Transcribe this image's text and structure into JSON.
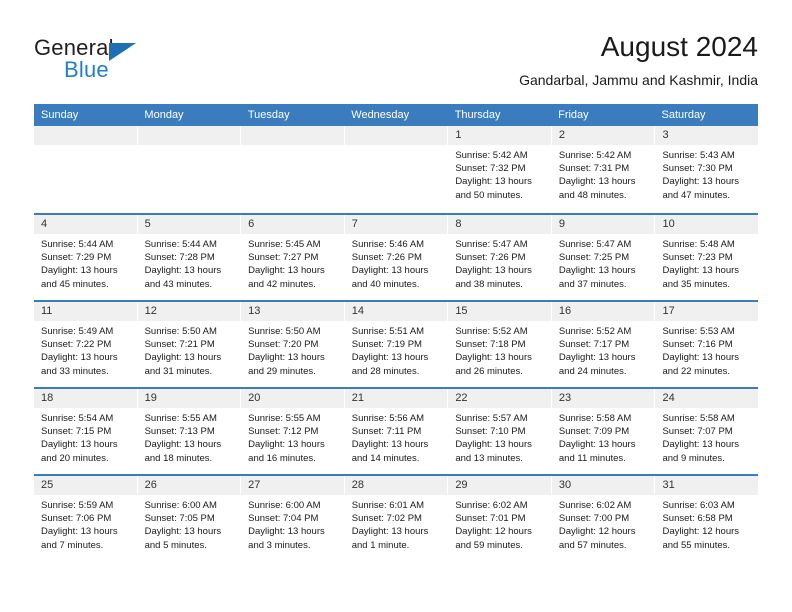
{
  "brand": {
    "name_part1": "General",
    "name_part2": "Blue",
    "accent_color": "#1f7fd0",
    "header_color": "#3a7cbe"
  },
  "header": {
    "title": "August 2024",
    "subtitle": "Gandarbal, Jammu and Kashmir, India"
  },
  "weekday_headers": [
    "Sunday",
    "Monday",
    "Tuesday",
    "Wednesday",
    "Thursday",
    "Friday",
    "Saturday"
  ],
  "weeks": [
    [
      {
        "day": "",
        "lines": [
          "",
          "",
          "",
          ""
        ]
      },
      {
        "day": "",
        "lines": [
          "",
          "",
          "",
          ""
        ]
      },
      {
        "day": "",
        "lines": [
          "",
          "",
          "",
          ""
        ]
      },
      {
        "day": "",
        "lines": [
          "",
          "",
          "",
          ""
        ]
      },
      {
        "day": "1",
        "lines": [
          "Sunrise: 5:42 AM",
          "Sunset: 7:32 PM",
          "Daylight: 13 hours",
          "and 50 minutes."
        ]
      },
      {
        "day": "2",
        "lines": [
          "Sunrise: 5:42 AM",
          "Sunset: 7:31 PM",
          "Daylight: 13 hours",
          "and 48 minutes."
        ]
      },
      {
        "day": "3",
        "lines": [
          "Sunrise: 5:43 AM",
          "Sunset: 7:30 PM",
          "Daylight: 13 hours",
          "and 47 minutes."
        ]
      }
    ],
    [
      {
        "day": "4",
        "lines": [
          "Sunrise: 5:44 AM",
          "Sunset: 7:29 PM",
          "Daylight: 13 hours",
          "and 45 minutes."
        ]
      },
      {
        "day": "5",
        "lines": [
          "Sunrise: 5:44 AM",
          "Sunset: 7:28 PM",
          "Daylight: 13 hours",
          "and 43 minutes."
        ]
      },
      {
        "day": "6",
        "lines": [
          "Sunrise: 5:45 AM",
          "Sunset: 7:27 PM",
          "Daylight: 13 hours",
          "and 42 minutes."
        ]
      },
      {
        "day": "7",
        "lines": [
          "Sunrise: 5:46 AM",
          "Sunset: 7:26 PM",
          "Daylight: 13 hours",
          "and 40 minutes."
        ]
      },
      {
        "day": "8",
        "lines": [
          "Sunrise: 5:47 AM",
          "Sunset: 7:26 PM",
          "Daylight: 13 hours",
          "and 38 minutes."
        ]
      },
      {
        "day": "9",
        "lines": [
          "Sunrise: 5:47 AM",
          "Sunset: 7:25 PM",
          "Daylight: 13 hours",
          "and 37 minutes."
        ]
      },
      {
        "day": "10",
        "lines": [
          "Sunrise: 5:48 AM",
          "Sunset: 7:23 PM",
          "Daylight: 13 hours",
          "and 35 minutes."
        ]
      }
    ],
    [
      {
        "day": "11",
        "lines": [
          "Sunrise: 5:49 AM",
          "Sunset: 7:22 PM",
          "Daylight: 13 hours",
          "and 33 minutes."
        ]
      },
      {
        "day": "12",
        "lines": [
          "Sunrise: 5:50 AM",
          "Sunset: 7:21 PM",
          "Daylight: 13 hours",
          "and 31 minutes."
        ]
      },
      {
        "day": "13",
        "lines": [
          "Sunrise: 5:50 AM",
          "Sunset: 7:20 PM",
          "Daylight: 13 hours",
          "and 29 minutes."
        ]
      },
      {
        "day": "14",
        "lines": [
          "Sunrise: 5:51 AM",
          "Sunset: 7:19 PM",
          "Daylight: 13 hours",
          "and 28 minutes."
        ]
      },
      {
        "day": "15",
        "lines": [
          "Sunrise: 5:52 AM",
          "Sunset: 7:18 PM",
          "Daylight: 13 hours",
          "and 26 minutes."
        ]
      },
      {
        "day": "16",
        "lines": [
          "Sunrise: 5:52 AM",
          "Sunset: 7:17 PM",
          "Daylight: 13 hours",
          "and 24 minutes."
        ]
      },
      {
        "day": "17",
        "lines": [
          "Sunrise: 5:53 AM",
          "Sunset: 7:16 PM",
          "Daylight: 13 hours",
          "and 22 minutes."
        ]
      }
    ],
    [
      {
        "day": "18",
        "lines": [
          "Sunrise: 5:54 AM",
          "Sunset: 7:15 PM",
          "Daylight: 13 hours",
          "and 20 minutes."
        ]
      },
      {
        "day": "19",
        "lines": [
          "Sunrise: 5:55 AM",
          "Sunset: 7:13 PM",
          "Daylight: 13 hours",
          "and 18 minutes."
        ]
      },
      {
        "day": "20",
        "lines": [
          "Sunrise: 5:55 AM",
          "Sunset: 7:12 PM",
          "Daylight: 13 hours",
          "and 16 minutes."
        ]
      },
      {
        "day": "21",
        "lines": [
          "Sunrise: 5:56 AM",
          "Sunset: 7:11 PM",
          "Daylight: 13 hours",
          "and 14 minutes."
        ]
      },
      {
        "day": "22",
        "lines": [
          "Sunrise: 5:57 AM",
          "Sunset: 7:10 PM",
          "Daylight: 13 hours",
          "and 13 minutes."
        ]
      },
      {
        "day": "23",
        "lines": [
          "Sunrise: 5:58 AM",
          "Sunset: 7:09 PM",
          "Daylight: 13 hours",
          "and 11 minutes."
        ]
      },
      {
        "day": "24",
        "lines": [
          "Sunrise: 5:58 AM",
          "Sunset: 7:07 PM",
          "Daylight: 13 hours",
          "and 9 minutes."
        ]
      }
    ],
    [
      {
        "day": "25",
        "lines": [
          "Sunrise: 5:59 AM",
          "Sunset: 7:06 PM",
          "Daylight: 13 hours",
          "and 7 minutes."
        ]
      },
      {
        "day": "26",
        "lines": [
          "Sunrise: 6:00 AM",
          "Sunset: 7:05 PM",
          "Daylight: 13 hours",
          "and 5 minutes."
        ]
      },
      {
        "day": "27",
        "lines": [
          "Sunrise: 6:00 AM",
          "Sunset: 7:04 PM",
          "Daylight: 13 hours",
          "and 3 minutes."
        ]
      },
      {
        "day": "28",
        "lines": [
          "Sunrise: 6:01 AM",
          "Sunset: 7:02 PM",
          "Daylight: 13 hours",
          "and 1 minute."
        ]
      },
      {
        "day": "29",
        "lines": [
          "Sunrise: 6:02 AM",
          "Sunset: 7:01 PM",
          "Daylight: 12 hours",
          "and 59 minutes."
        ]
      },
      {
        "day": "30",
        "lines": [
          "Sunrise: 6:02 AM",
          "Sunset: 7:00 PM",
          "Daylight: 12 hours",
          "and 57 minutes."
        ]
      },
      {
        "day": "31",
        "lines": [
          "Sunrise: 6:03 AM",
          "Sunset: 6:58 PM",
          "Daylight: 12 hours",
          "and 55 minutes."
        ]
      }
    ]
  ]
}
